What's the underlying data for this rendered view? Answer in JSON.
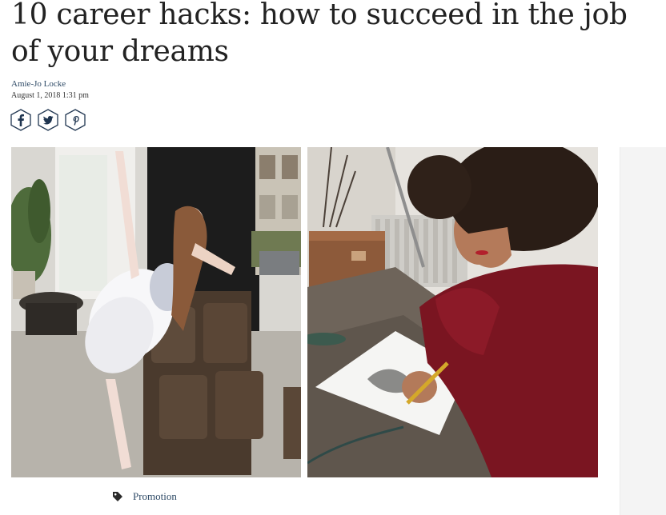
{
  "article": {
    "title": "10 career hacks: how to succeed in the job of your dreams",
    "author": "Amie-Jo Locke",
    "date": "August 1, 2018 1:31 pm"
  },
  "share_buttons": [
    {
      "icon": "facebook-icon"
    },
    {
      "icon": "twitter-icon"
    },
    {
      "icon": "pinterest-icon"
    }
  ],
  "tags": {
    "icon": "tag-icon",
    "items": [
      "Promotion"
    ]
  },
  "colors": {
    "link": "#2e4a66",
    "icon_stroke": "#1f3550",
    "ad_background": "#f4f4f4"
  }
}
